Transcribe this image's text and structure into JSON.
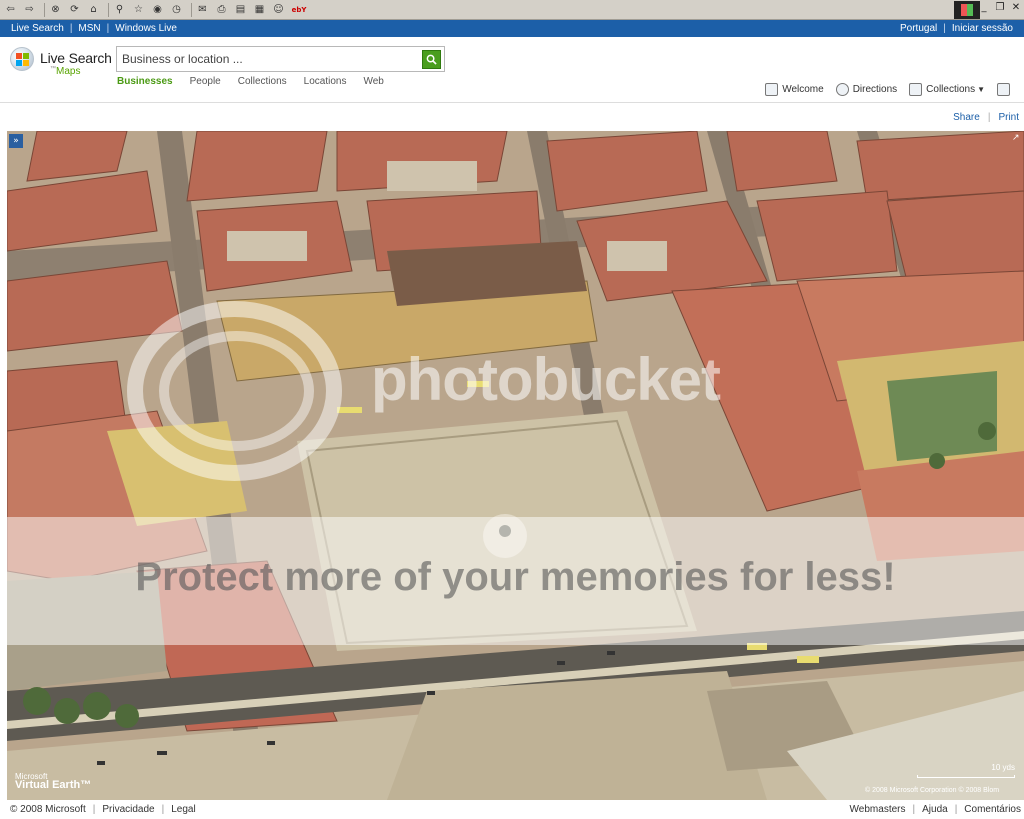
{
  "browser": {
    "toolbar_icons": [
      "back-icon",
      "forward-icon",
      "stop-icon",
      "refresh-icon",
      "home-icon",
      "search-icon",
      "favorites-icon",
      "media-icon",
      "history-icon",
      "mail-icon",
      "print-icon",
      "edit-icon",
      "discuss-icon",
      "messenger-icon",
      "ebay-icon"
    ],
    "ebay_label": "ebY"
  },
  "topnav": {
    "live_search": "Live Search",
    "msn": "MSN",
    "windows_live": "Windows Live",
    "region": "Portugal",
    "signin": "Iniciar sessão",
    "sep": "|"
  },
  "header": {
    "logo_title": "Live Search",
    "logo_tm": "™",
    "logo_sub": "Maps",
    "search_placeholder": "Business or location ...",
    "tabs": [
      {
        "label": "Businesses",
        "active": true
      },
      {
        "label": "People",
        "active": false
      },
      {
        "label": "Collections",
        "active": false
      },
      {
        "label": "Locations",
        "active": false
      },
      {
        "label": "Web",
        "active": false
      }
    ],
    "actions": {
      "welcome": "Welcome",
      "directions": "Directions",
      "collections": "Collections"
    }
  },
  "sharebar": {
    "share": "Share",
    "print": "Print",
    "sep": "|"
  },
  "map": {
    "collapse_glyph": "»",
    "watermark_logo": "photobucket",
    "watermark_text": "Protect more of your memories for less!",
    "ve_top": "Microsoft",
    "ve_bottom": "Virtual Earth™",
    "copyright": "© 2008 Microsoft Corporation  © 2008 Blom",
    "scale_label": "10 yds"
  },
  "footer": {
    "copyright": "© 2008 Microsoft",
    "privacy": "Privacidade",
    "legal": "Legal",
    "webmasters": "Webmasters",
    "help": "Ajuda",
    "comments": "Comentários",
    "sep": "|"
  },
  "colors": {
    "nav_blue": "#1c5fa8",
    "accent_green": "#4b9a14",
    "roof": "#b46450",
    "square": "#c8bea8"
  }
}
